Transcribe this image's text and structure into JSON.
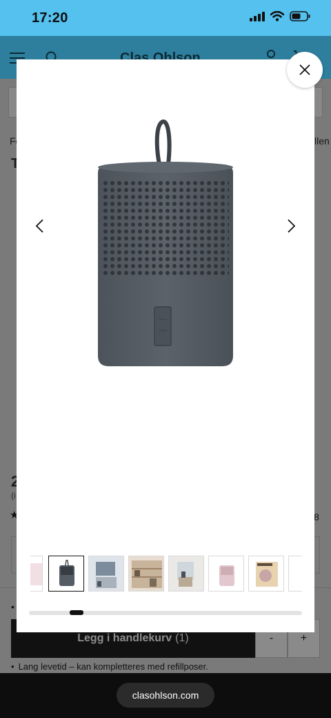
{
  "status_bar": {
    "time": "17:20",
    "icons": [
      "signal-icon",
      "wifi-icon",
      "battery-icon"
    ]
  },
  "site": {
    "logo": "Clas Ohlson",
    "icons": [
      "menu-icon",
      "search-icon",
      "account-icon",
      "cart-icon"
    ]
  },
  "background_page": {
    "breadcrumb_left": "Fo",
    "breadcrumb_right": "llen",
    "title": "T",
    "price": "2",
    "price_sub": "(i",
    "rating_star": "★",
    "review_count": "8",
    "bullet_1": "•",
    "add_to_cart": {
      "label": "Legg i handlekurv",
      "quantity": "(1)"
    },
    "qty_minus": "-",
    "qty_plus": "+",
    "bullet_2": "Lang levetid – kan kompletteres med refillposer."
  },
  "browser": {
    "url": "clasohlson.com"
  },
  "gallery": {
    "close_icon": "close-icon",
    "prev_icon": "chevron-left-icon",
    "next_icon": "chevron-right-icon",
    "main_image": "dehumidifier-product-image",
    "active_thumbnail": 1,
    "thumbnails": [
      "thumbnail-partial",
      "thumbnail-product-grey",
      "thumbnail-kitchen",
      "thumbnail-shelves",
      "thumbnail-room",
      "thumbnail-product-pink",
      "thumbnail-packaging",
      "thumbnail-partial-end"
    ],
    "scroll_position": 0.16,
    "colors": {
      "product": "#535a62",
      "accent": "#111111"
    }
  }
}
